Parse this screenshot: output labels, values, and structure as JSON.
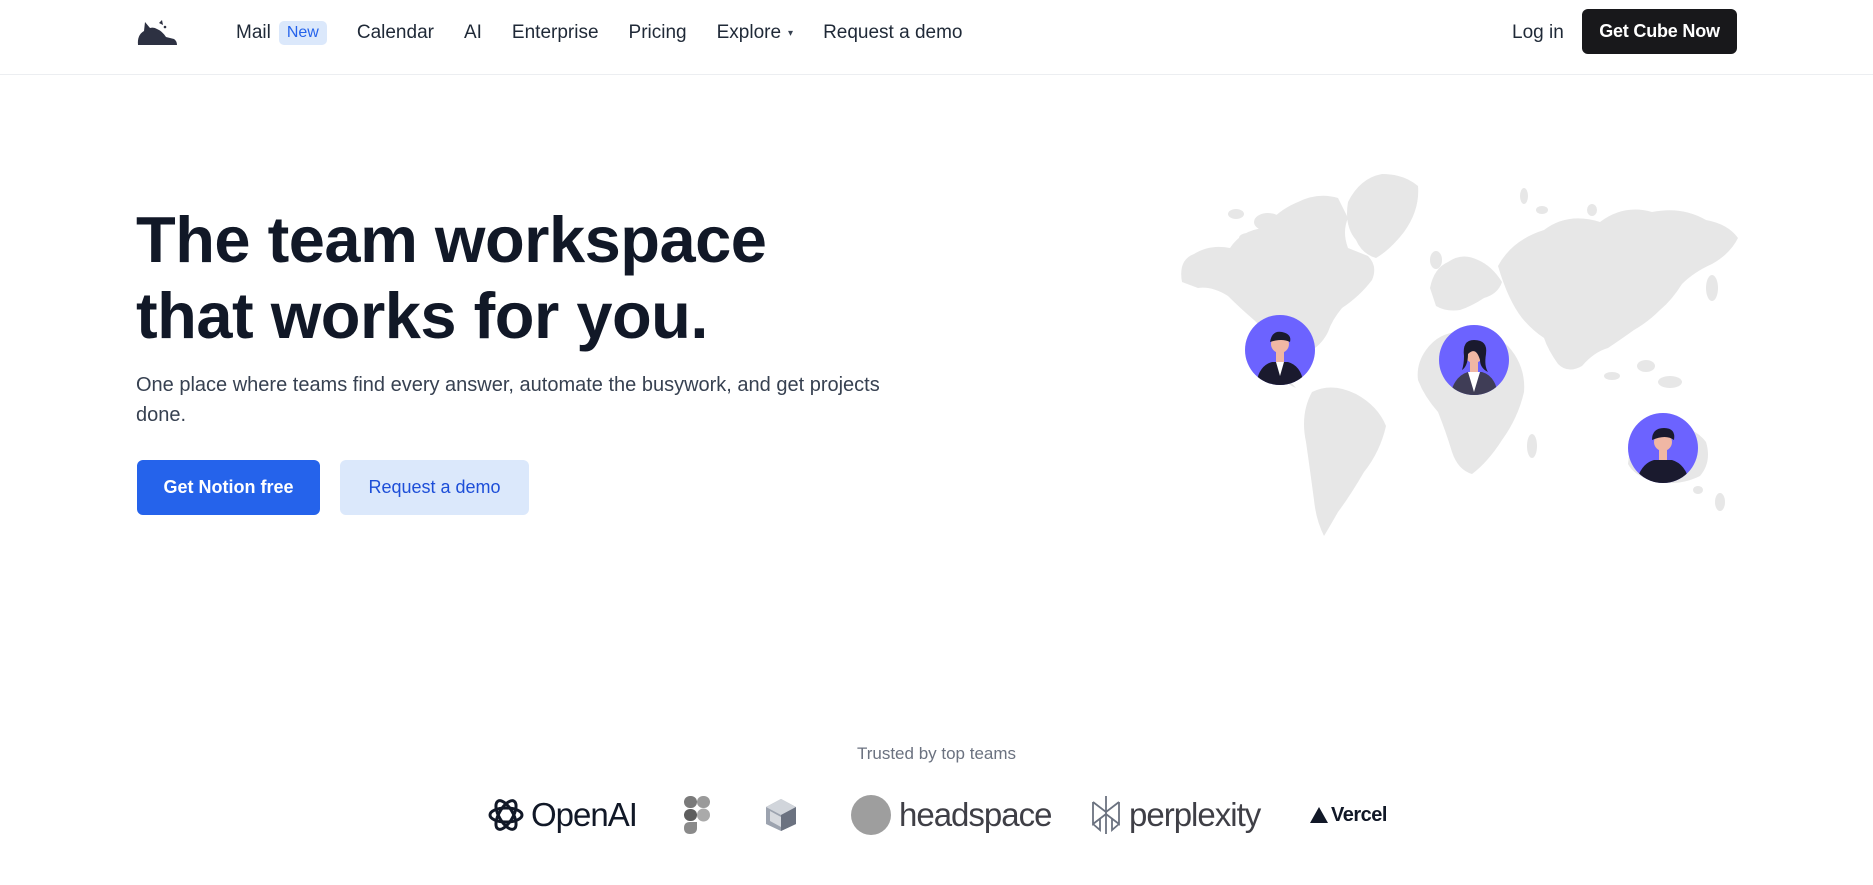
{
  "nav": {
    "links": [
      {
        "label": "Mail",
        "badge": "New"
      },
      {
        "label": "Calendar"
      },
      {
        "label": "AI"
      },
      {
        "label": "Enterprise"
      },
      {
        "label": "Pricing"
      },
      {
        "label": "Explore",
        "caret": "▾"
      },
      {
        "label": "Request a demo"
      }
    ],
    "login_label": "Log in",
    "cta_label": "Get Cube Now"
  },
  "hero": {
    "title_line1": "The team workspace",
    "title_line2": "that works for you.",
    "subtitle": "One place where teams find every answer, automate the busywork, and get projects done.",
    "primary_cta": "Get Notion free",
    "secondary_cta": "Request a demo"
  },
  "trusted": {
    "label": "Trusted by top teams",
    "logos": [
      {
        "name": "OpenAI",
        "icon": "openai-icon"
      },
      {
        "name": "",
        "icon": "figma-icon"
      },
      {
        "name": "",
        "icon": "cube-logo-icon"
      },
      {
        "name": "headspace",
        "icon": "headspace-icon"
      },
      {
        "name": "perplexity",
        "icon": "perplexity-icon"
      },
      {
        "name": "Vercel",
        "icon": "vercel-icon"
      }
    ]
  },
  "colors": {
    "primary": "#2563eb",
    "secondary_bg": "#dbe8fb",
    "dark_button": "#18181b",
    "map_land": "#e7e7e7",
    "avatar_bg": "#6c63ff"
  }
}
